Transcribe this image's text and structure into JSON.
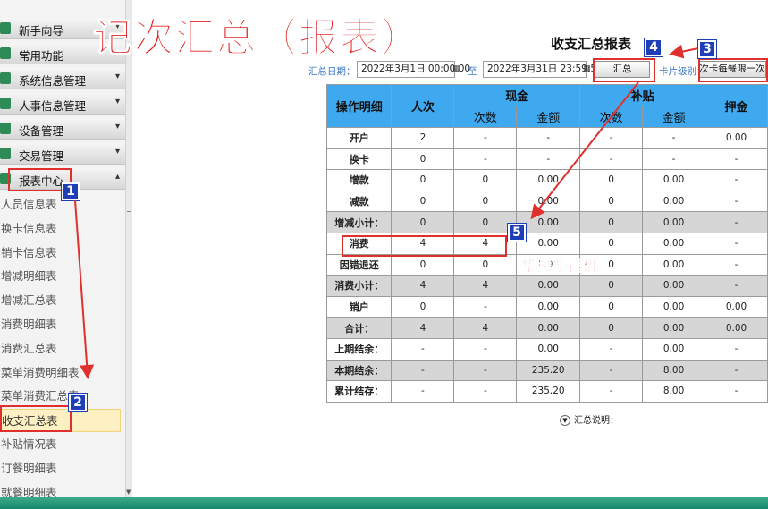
{
  "sidebar": {
    "groups": [
      {
        "label": "新手向导",
        "icon": "guide-icon",
        "color": "#2e8b57",
        "chevron": "▾"
      },
      {
        "label": "常用功能",
        "icon": "star-icon",
        "color": "#2e8b57",
        "chevron": ""
      },
      {
        "label": "系统信息管理",
        "icon": "system-icon",
        "color": "#2e8b57",
        "chevron": "▾"
      },
      {
        "label": "人事信息管理",
        "icon": "people-icon",
        "color": "#2e8b57",
        "chevron": "▾"
      },
      {
        "label": "设备管理",
        "icon": "device-icon",
        "color": "#2e8b57",
        "chevron": "▾"
      },
      {
        "label": "交易管理",
        "icon": "trade-icon",
        "color": "#2e8b57",
        "chevron": "▾"
      },
      {
        "label": "报表中心",
        "icon": "report-icon",
        "color": "#2e8b57",
        "chevron": "▴"
      }
    ],
    "report_items": [
      "人员信息表",
      "换卡信息表",
      "销卡信息表",
      "增减明细表",
      "增减汇总表",
      "消费明细表",
      "消费汇总表",
      "菜单消费明细表",
      "菜单消费汇总表",
      "收支汇总表",
      "补贴情况表",
      "订餐明细表",
      "就餐明细表"
    ],
    "active_item": "收支汇总表"
  },
  "main": {
    "title": "收支汇总报表",
    "filters": {
      "date_label": "汇总日期：",
      "start_date": "2022年3月1日 00:00:00",
      "to_label": "至",
      "end_date": "2022年3月31日 23:59:59",
      "summarize_button": "汇总",
      "card_level_label": "卡片级别：",
      "card_level_button": "次卡每餐限一次"
    },
    "table": {
      "header_row1": {
        "item": "操作明细",
        "count": "人次",
        "cash": "现金",
        "subsidy": "补贴",
        "deposit": "押金"
      },
      "header_row2": [
        "次数",
        "金额",
        "次数",
        "金额"
      ],
      "rows": [
        {
          "label": "开户",
          "values": [
            "2",
            "-",
            "-",
            "-",
            "-",
            "0.00"
          ],
          "shaded": false
        },
        {
          "label": "换卡",
          "values": [
            "0",
            "-",
            "-",
            "-",
            "-",
            "-"
          ],
          "shaded": false
        },
        {
          "label": "增款",
          "values": [
            "0",
            "0",
            "0.00",
            "0",
            "0.00",
            "-"
          ],
          "shaded": false
        },
        {
          "label": "减款",
          "values": [
            "0",
            "0",
            "0.00",
            "0",
            "0.00",
            "-"
          ],
          "shaded": false
        },
        {
          "label": "增减小计：",
          "values": [
            "0",
            "0",
            "0.00",
            "0",
            "0.00",
            "-"
          ],
          "shaded": true
        },
        {
          "label": "消费",
          "values": [
            "4",
            "4",
            "0.00",
            "0",
            "0.00",
            "-"
          ],
          "shaded": false
        },
        {
          "label": "因错退还",
          "values": [
            "0",
            "0",
            "0.00",
            "0",
            "0.00",
            "-"
          ],
          "shaded": false
        },
        {
          "label": "消费小计：",
          "values": [
            "4",
            "4",
            "0.00",
            "0",
            "0.00",
            "-"
          ],
          "shaded": true
        },
        {
          "label": "销户",
          "values": [
            "0",
            "-",
            "0.00",
            "0",
            "0.00",
            "0.00"
          ],
          "shaded": false
        },
        {
          "label": "合计：",
          "values": [
            "4",
            "4",
            "0.00",
            "0",
            "0.00",
            "0.00"
          ],
          "shaded": true
        },
        {
          "label": "上期结余：",
          "values": [
            "-",
            "-",
            "0.00",
            "-",
            "0.00",
            "-"
          ],
          "shaded": false
        },
        {
          "label": "本期结余：",
          "values": [
            "-",
            "-",
            "235.20",
            "-",
            "8.00",
            "-"
          ],
          "shaded": true
        },
        {
          "label": "累计结存：",
          "values": [
            "-",
            "-",
            "235.20",
            "-",
            "8.00",
            "-"
          ],
          "shaded": false
        }
      ]
    },
    "summary_note": "汇总说明：",
    "summary_toggle_icon": "chevron-down-icon"
  },
  "annotations": {
    "title": "记次汇总（报表）",
    "watermark": "华腾就餐机",
    "steps": [
      "1",
      "2",
      "3",
      "4",
      "5"
    ],
    "color": "#e0302e"
  }
}
